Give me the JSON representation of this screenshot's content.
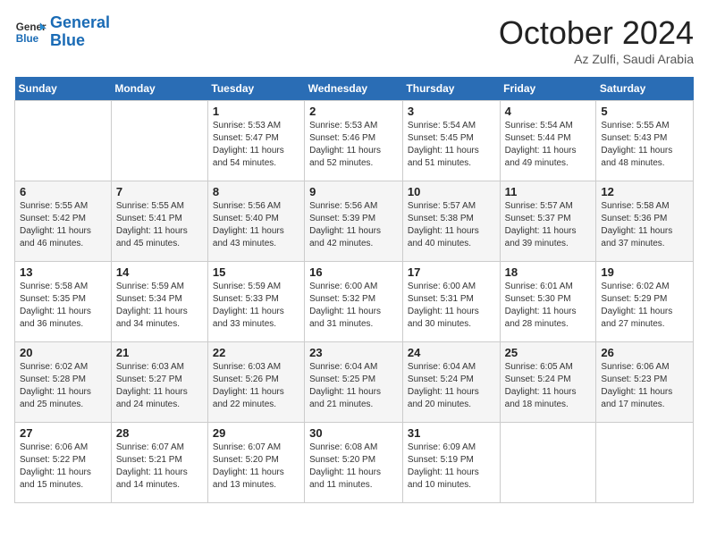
{
  "logo": {
    "line1": "General",
    "line2": "Blue"
  },
  "header": {
    "month": "October 2024",
    "location": "Az Zulfi, Saudi Arabia"
  },
  "weekdays": [
    "Sunday",
    "Monday",
    "Tuesday",
    "Wednesday",
    "Thursday",
    "Friday",
    "Saturday"
  ],
  "weeks": [
    [
      {
        "day": "",
        "sunrise": "",
        "sunset": "",
        "daylight": ""
      },
      {
        "day": "",
        "sunrise": "",
        "sunset": "",
        "daylight": ""
      },
      {
        "day": "1",
        "sunrise": "5:53 AM",
        "sunset": "5:47 PM",
        "daylight": "11 hours and 54 minutes."
      },
      {
        "day": "2",
        "sunrise": "5:53 AM",
        "sunset": "5:46 PM",
        "daylight": "11 hours and 52 minutes."
      },
      {
        "day": "3",
        "sunrise": "5:54 AM",
        "sunset": "5:45 PM",
        "daylight": "11 hours and 51 minutes."
      },
      {
        "day": "4",
        "sunrise": "5:54 AM",
        "sunset": "5:44 PM",
        "daylight": "11 hours and 49 minutes."
      },
      {
        "day": "5",
        "sunrise": "5:55 AM",
        "sunset": "5:43 PM",
        "daylight": "11 hours and 48 minutes."
      }
    ],
    [
      {
        "day": "6",
        "sunrise": "5:55 AM",
        "sunset": "5:42 PM",
        "daylight": "11 hours and 46 minutes."
      },
      {
        "day": "7",
        "sunrise": "5:55 AM",
        "sunset": "5:41 PM",
        "daylight": "11 hours and 45 minutes."
      },
      {
        "day": "8",
        "sunrise": "5:56 AM",
        "sunset": "5:40 PM",
        "daylight": "11 hours and 43 minutes."
      },
      {
        "day": "9",
        "sunrise": "5:56 AM",
        "sunset": "5:39 PM",
        "daylight": "11 hours and 42 minutes."
      },
      {
        "day": "10",
        "sunrise": "5:57 AM",
        "sunset": "5:38 PM",
        "daylight": "11 hours and 40 minutes."
      },
      {
        "day": "11",
        "sunrise": "5:57 AM",
        "sunset": "5:37 PM",
        "daylight": "11 hours and 39 minutes."
      },
      {
        "day": "12",
        "sunrise": "5:58 AM",
        "sunset": "5:36 PM",
        "daylight": "11 hours and 37 minutes."
      }
    ],
    [
      {
        "day": "13",
        "sunrise": "5:58 AM",
        "sunset": "5:35 PM",
        "daylight": "11 hours and 36 minutes."
      },
      {
        "day": "14",
        "sunrise": "5:59 AM",
        "sunset": "5:34 PM",
        "daylight": "11 hours and 34 minutes."
      },
      {
        "day": "15",
        "sunrise": "5:59 AM",
        "sunset": "5:33 PM",
        "daylight": "11 hours and 33 minutes."
      },
      {
        "day": "16",
        "sunrise": "6:00 AM",
        "sunset": "5:32 PM",
        "daylight": "11 hours and 31 minutes."
      },
      {
        "day": "17",
        "sunrise": "6:00 AM",
        "sunset": "5:31 PM",
        "daylight": "11 hours and 30 minutes."
      },
      {
        "day": "18",
        "sunrise": "6:01 AM",
        "sunset": "5:30 PM",
        "daylight": "11 hours and 28 minutes."
      },
      {
        "day": "19",
        "sunrise": "6:02 AM",
        "sunset": "5:29 PM",
        "daylight": "11 hours and 27 minutes."
      }
    ],
    [
      {
        "day": "20",
        "sunrise": "6:02 AM",
        "sunset": "5:28 PM",
        "daylight": "11 hours and 25 minutes."
      },
      {
        "day": "21",
        "sunrise": "6:03 AM",
        "sunset": "5:27 PM",
        "daylight": "11 hours and 24 minutes."
      },
      {
        "day": "22",
        "sunrise": "6:03 AM",
        "sunset": "5:26 PM",
        "daylight": "11 hours and 22 minutes."
      },
      {
        "day": "23",
        "sunrise": "6:04 AM",
        "sunset": "5:25 PM",
        "daylight": "11 hours and 21 minutes."
      },
      {
        "day": "24",
        "sunrise": "6:04 AM",
        "sunset": "5:24 PM",
        "daylight": "11 hours and 20 minutes."
      },
      {
        "day": "25",
        "sunrise": "6:05 AM",
        "sunset": "5:24 PM",
        "daylight": "11 hours and 18 minutes."
      },
      {
        "day": "26",
        "sunrise": "6:06 AM",
        "sunset": "5:23 PM",
        "daylight": "11 hours and 17 minutes."
      }
    ],
    [
      {
        "day": "27",
        "sunrise": "6:06 AM",
        "sunset": "5:22 PM",
        "daylight": "11 hours and 15 minutes."
      },
      {
        "day": "28",
        "sunrise": "6:07 AM",
        "sunset": "5:21 PM",
        "daylight": "11 hours and 14 minutes."
      },
      {
        "day": "29",
        "sunrise": "6:07 AM",
        "sunset": "5:20 PM",
        "daylight": "11 hours and 13 minutes."
      },
      {
        "day": "30",
        "sunrise": "6:08 AM",
        "sunset": "5:20 PM",
        "daylight": "11 hours and 11 minutes."
      },
      {
        "day": "31",
        "sunrise": "6:09 AM",
        "sunset": "5:19 PM",
        "daylight": "11 hours and 10 minutes."
      },
      {
        "day": "",
        "sunrise": "",
        "sunset": "",
        "daylight": ""
      },
      {
        "day": "",
        "sunrise": "",
        "sunset": "",
        "daylight": ""
      }
    ]
  ]
}
